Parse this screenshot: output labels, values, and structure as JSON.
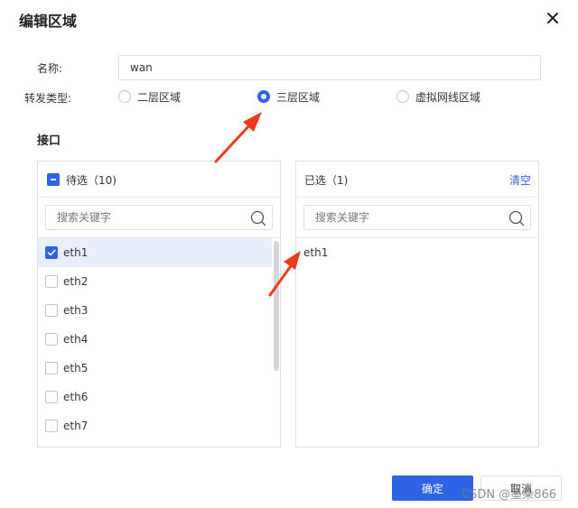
{
  "dialog": {
    "title": "编辑区域"
  },
  "form": {
    "name_label": "名称:",
    "name_value": "wan",
    "type_label": "转发类型:",
    "radios": [
      {
        "label": "二层区域",
        "checked": false
      },
      {
        "label": "三层区域",
        "checked": true
      },
      {
        "label": "虚拟网线区域",
        "checked": false
      }
    ]
  },
  "interfaces": {
    "section_title": "接口",
    "available": {
      "header": "待选（10)",
      "search_placeholder": "搜索关键字",
      "items": [
        {
          "label": "eth1",
          "checked": true
        },
        {
          "label": "eth2",
          "checked": false
        },
        {
          "label": "eth3",
          "checked": false
        },
        {
          "label": "eth4",
          "checked": false
        },
        {
          "label": "eth5",
          "checked": false
        },
        {
          "label": "eth6",
          "checked": false
        },
        {
          "label": "eth7",
          "checked": false
        }
      ]
    },
    "selected": {
      "header": "已选（1)",
      "clear_label": "清空",
      "search_placeholder": "搜索关键字",
      "items": [
        {
          "label": "eth1"
        }
      ]
    }
  },
  "buttons": {
    "ok": "确定",
    "cancel": "取消"
  },
  "watermark": "CSDN @墨染866",
  "colors": {
    "accent": "#2d64e3",
    "annotation_arrow": "#f03a1e"
  }
}
